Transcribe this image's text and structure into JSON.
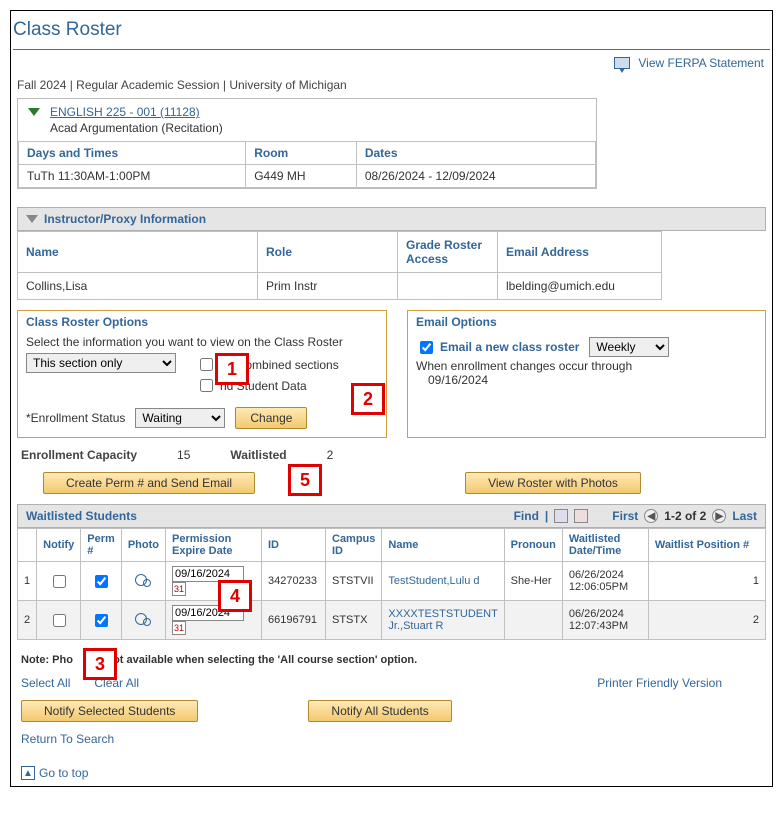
{
  "title": "Class Roster",
  "header": {
    "ferpa_label": "View FERPA Statement"
  },
  "session_line": "Fall 2024 | Regular Academic Session | University of Michigan",
  "course": {
    "link": "ENGLISH 225 - 001 (11128)",
    "subtitle": "Acad Argumentation (Recitation)",
    "cols": {
      "days": "Days and Times",
      "room": "Room",
      "dates": "Dates"
    },
    "row": {
      "days": "TuTh 11:30AM-1:00PM",
      "room": "G449 MH",
      "dates": "08/26/2024 - 12/09/2024"
    }
  },
  "instructor": {
    "title": "Instructor/Proxy Information",
    "cols": {
      "name": "Name",
      "role": "Role",
      "gra": "Grade Roster Access",
      "email": "Email Address"
    },
    "row": {
      "name": "Collins,Lisa",
      "role": "Prim Instr",
      "gra": "",
      "email": "lbelding@umich.edu"
    }
  },
  "class_options": {
    "title": "Class Roster Options",
    "subtitle": "Select the information you want to view on the Class Roster",
    "section_select": "This section only",
    "chk1_label": "de Combined sections",
    "chk2_label": "nd Student Data",
    "enroll_label": "*Enrollment Status",
    "enroll_select": "Waiting",
    "change_btn": "Change"
  },
  "email_options": {
    "title": "Email Options",
    "chk_label": "Email a new class roster",
    "freq_select": "Weekly",
    "line1": "When enrollment changes occur through",
    "line2": "09/16/2024"
  },
  "capacity": {
    "label": "Enrollment Capacity",
    "value": "15",
    "wait_label": "Waitlisted",
    "wait_value": "2"
  },
  "buttons": {
    "perm": "Create Perm # and Send Email",
    "photos": "View Roster with Photos",
    "notify_selected": "Notify Selected Students",
    "notify_all": "Notify All Students"
  },
  "grid": {
    "title": "Waitlisted Students",
    "toolbar": {
      "find": "Find",
      "first": "First",
      "range": "1-2 of 2",
      "last": "Last"
    },
    "cols": {
      "row": "",
      "notify": "Notify",
      "perm": "Perm #",
      "photo": "Photo",
      "exp": "Permission Expire Date",
      "id": "ID",
      "campus": "Campus ID",
      "name": "Name",
      "pronoun": "Pronoun",
      "wdt": "Waitlisted Date/Time",
      "pos": "Waitlist Position #"
    },
    "rows": [
      {
        "n": "1",
        "notify": false,
        "perm": true,
        "exp": "09/16/2024",
        "id": "34270233",
        "campus": "STSTVII",
        "name": "TestStudent,Lulu d",
        "pronoun": "She-Her",
        "wdt": "06/26/2024 12:06:05PM",
        "pos": "1"
      },
      {
        "n": "2",
        "notify": false,
        "perm": true,
        "exp": "09/16/2024",
        "id": "66196791",
        "campus": "STSTX",
        "name": "XXXXTESTSTUDENT Jr.,Stuart R",
        "pronoun": "",
        "wdt": "06/26/2024 12:07:43PM",
        "pos": "2"
      }
    ]
  },
  "note_prefix": "Note: Pho",
  "note_suffix": "ot available when selecting the 'All course section' option.",
  "links": {
    "select_all": "Select All",
    "clear_all": "Clear All",
    "printer": "Printer Friendly Version",
    "return": "Return To Search",
    "goto": "Go to top"
  },
  "markers": {
    "m1": "1",
    "m2": "2",
    "m3": "3",
    "m4": "4",
    "m5": "5"
  }
}
